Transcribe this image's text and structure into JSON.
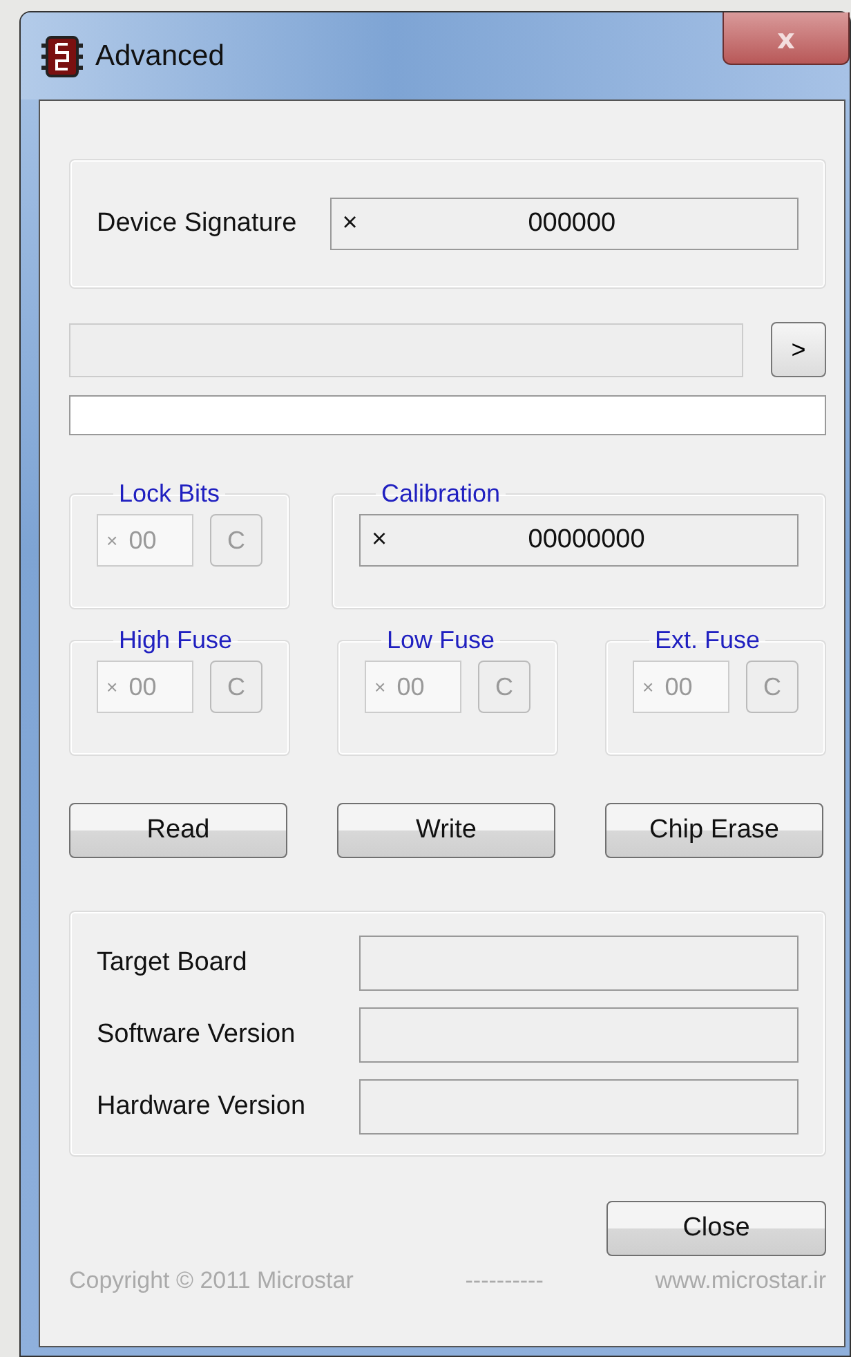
{
  "window": {
    "title": "Advanced",
    "close": "x"
  },
  "device_signature": {
    "label": "Device Signature",
    "prefix": "×",
    "value": "000000"
  },
  "address": {
    "go": ">"
  },
  "lock_bits": {
    "label": "Lock Bits",
    "prefix": "×",
    "value": "00",
    "button": "C",
    "disabled": true
  },
  "calibration": {
    "label": "Calibration",
    "prefix": "×",
    "value": "00000000"
  },
  "fuses": [
    {
      "label": "High Fuse",
      "prefix": "×",
      "value": "00",
      "button": "C",
      "disabled": true
    },
    {
      "label": "Low Fuse",
      "prefix": "×",
      "value": "00",
      "button": "C",
      "disabled": true
    },
    {
      "label": "Ext. Fuse",
      "prefix": "×",
      "value": "00",
      "button": "C",
      "disabled": true
    }
  ],
  "actions": [
    "Read",
    "Write",
    "Chip Erase"
  ],
  "info": [
    {
      "label": "Target Board"
    },
    {
      "label": "Software Version"
    },
    {
      "label": "Hardware Version"
    }
  ],
  "close_button": "Close",
  "footer": {
    "copyright": "Copyright © 2011 Microstar",
    "separator": "----------",
    "website": "www.microstar.ir"
  }
}
